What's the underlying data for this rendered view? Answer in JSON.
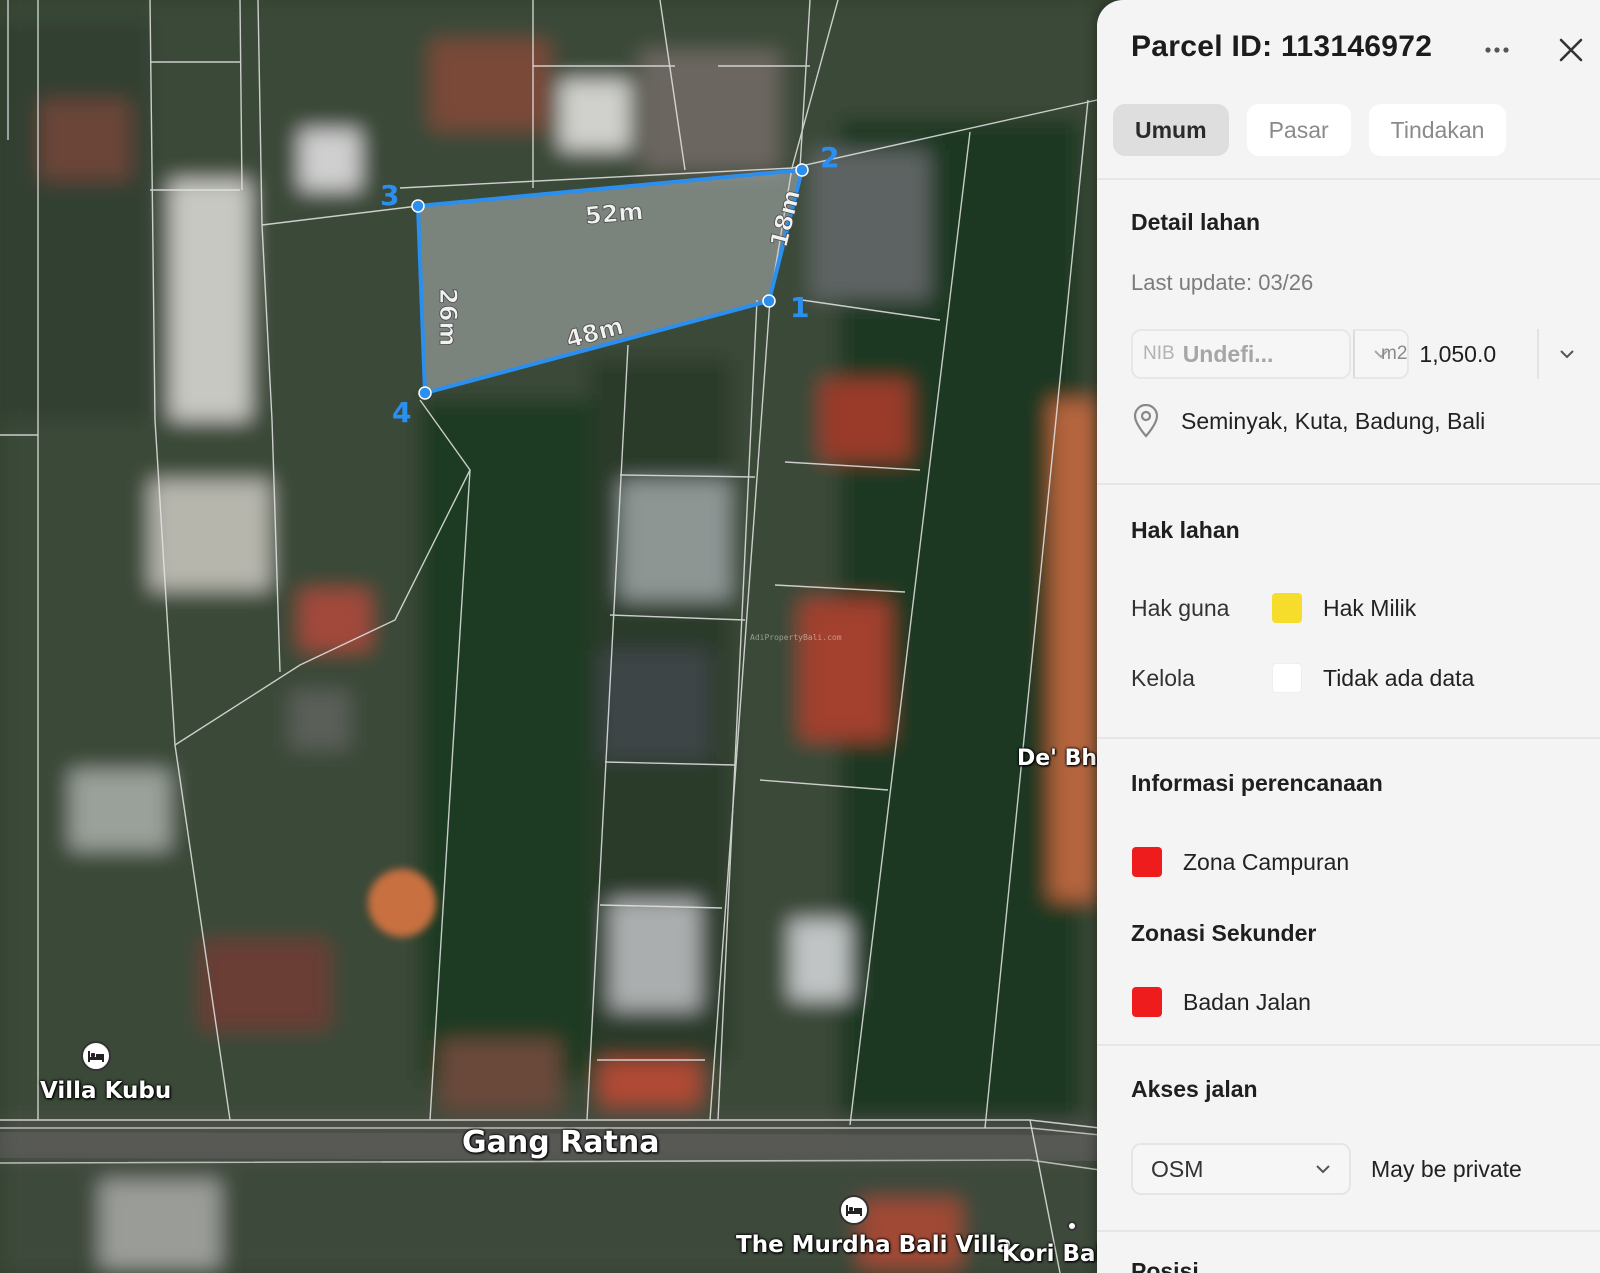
{
  "map": {
    "parcel": {
      "vertex_labels": [
        "1",
        "2",
        "3",
        "4"
      ],
      "edge_labels": [
        "52m",
        "18m",
        "26m",
        "48m"
      ]
    },
    "labels": {
      "street": "Gang Ratna",
      "poi_villa_kubu": "Villa Kubu",
      "poi_murdha": "The Murdha Bali Villa",
      "poi_kori": "Kori Bali",
      "poi_debha": "De' Bha"
    },
    "watermark": "AdiPropertyBali.com",
    "colors": {
      "parcel_outline": "#2b8ff0",
      "parcel_fill": "rgba(200,205,210,0.45)"
    }
  },
  "panel": {
    "title": "Parcel ID: 113146972",
    "tabs": [
      {
        "label": "Umum",
        "active": true
      },
      {
        "label": "Pasar",
        "active": false
      },
      {
        "label": "Tindakan",
        "active": false
      }
    ],
    "land_detail": {
      "heading": "Detail lahan",
      "last_update": "Last update: 03/26",
      "nib_prefix": "NIB",
      "nib_value": "Undefi...",
      "area_prefix": "m2",
      "area_value": "1,050.0",
      "location": "Seminyak, Kuta, Badung, Bali"
    },
    "land_rights": {
      "heading": "Hak lahan",
      "rows": [
        {
          "label": "Hak guna",
          "value": "Hak Milik",
          "color": "#f6dc2b"
        },
        {
          "label": "Kelola",
          "value": "Tidak ada data",
          "color": "#ffffff"
        }
      ]
    },
    "planning": {
      "heading": "Informasi perencanaan",
      "primary": {
        "value": "Zona Campuran",
        "color": "#ee1c1c"
      },
      "secondary_heading": "Zonasi Sekunder",
      "secondary": {
        "value": "Badan Jalan",
        "color": "#ee1c1c"
      }
    },
    "road_access": {
      "heading": "Akses jalan",
      "select_value": "OSM",
      "note": "May be private"
    },
    "next_heading": "Posisi"
  }
}
